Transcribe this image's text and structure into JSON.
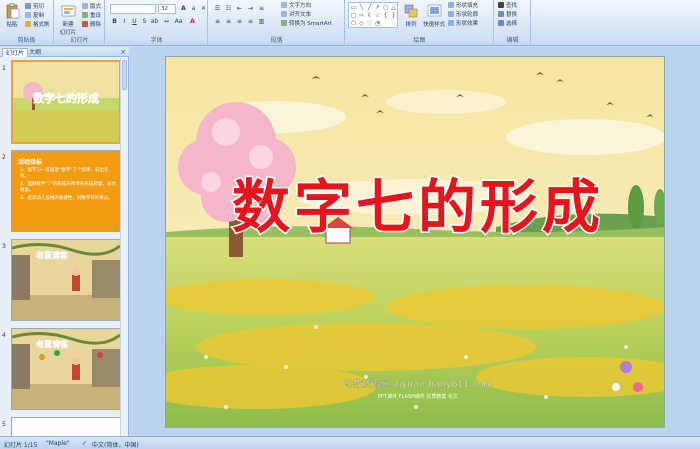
{
  "ribbon": {
    "clipboard": {
      "paste": "粘贴",
      "cut": "剪切",
      "copy": "复制",
      "format_painter": "格式刷",
      "label": "剪贴板"
    },
    "slides": {
      "new_slide_line1": "新建",
      "new_slide_line2": "幻灯片",
      "layout": "版式",
      "reset": "重设",
      "delete": "删除",
      "label": "幻灯片"
    },
    "font": {
      "font_size": "32",
      "label": "字体"
    },
    "paragraph": {
      "text_direction": "文字方向",
      "align_text": "对齐文本",
      "smartart": "转换为 SmartArt",
      "label": "段落"
    },
    "drawing": {
      "arrange": "排列",
      "quick_styles": "快速样式",
      "shape_fill": "形状填充",
      "shape_outline": "形状轮廓",
      "shape_effects": "形状效果",
      "label": "绘图"
    },
    "editing": {
      "find": "查找",
      "replace": "替换",
      "select": "选择",
      "label": "编辑"
    }
  },
  "panel": {
    "tab_slides": "幻灯片",
    "tab_outline": "大纲",
    "close": "×"
  },
  "thumbnails": [
    {
      "number": "1",
      "title": "数字七的形成"
    },
    {
      "number": "2",
      "heading": "活动目标",
      "lines": [
        "1、能学习一首短歌“数字”了个韵律，说出名称。",
        "2、理解数字“7”的形成的简单的形成原理，表达数量。",
        "3、提高幼儿思维的敏捷性，对数字有好奇心。"
      ]
    },
    {
      "number": "3",
      "title": "老鼠请客"
    },
    {
      "number": "4",
      "title": "老鼠请客"
    },
    {
      "number": "5"
    }
  ],
  "slide": {
    "title": "数字七的形成",
    "watermark_main": "幼教资源网 ziyuan.baby611.com",
    "watermark_sub": "PPT课件 FLASH课件 优质教案 论文"
  },
  "status": {
    "slide_count": "幻灯片 1/15",
    "theme": "\"Maple\"",
    "language": "中文(简体，中国)"
  },
  "colors": {
    "title_fill": "#e8141c",
    "title_outline": "#ffffff",
    "thumb2_bg": "#f39c12"
  }
}
